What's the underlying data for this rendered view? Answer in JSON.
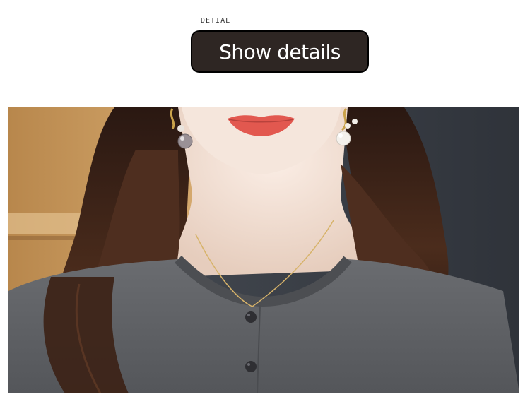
{
  "header": {
    "small_label": "DETIAL",
    "title": "Show details"
  },
  "colors": {
    "pill_bg": "#2e2623",
    "sweater": "#5d5f63",
    "hair": "#3a2218",
    "skin": "#f2dfd3",
    "wall_left": "#c89a5e",
    "wall_right": "#3b3f46"
  },
  "photo": {
    "subject": "woman in grey knit cardigan",
    "icons": [
      "pearl-earring-icon",
      "pendant-necklace-icon",
      "button-icon"
    ]
  }
}
